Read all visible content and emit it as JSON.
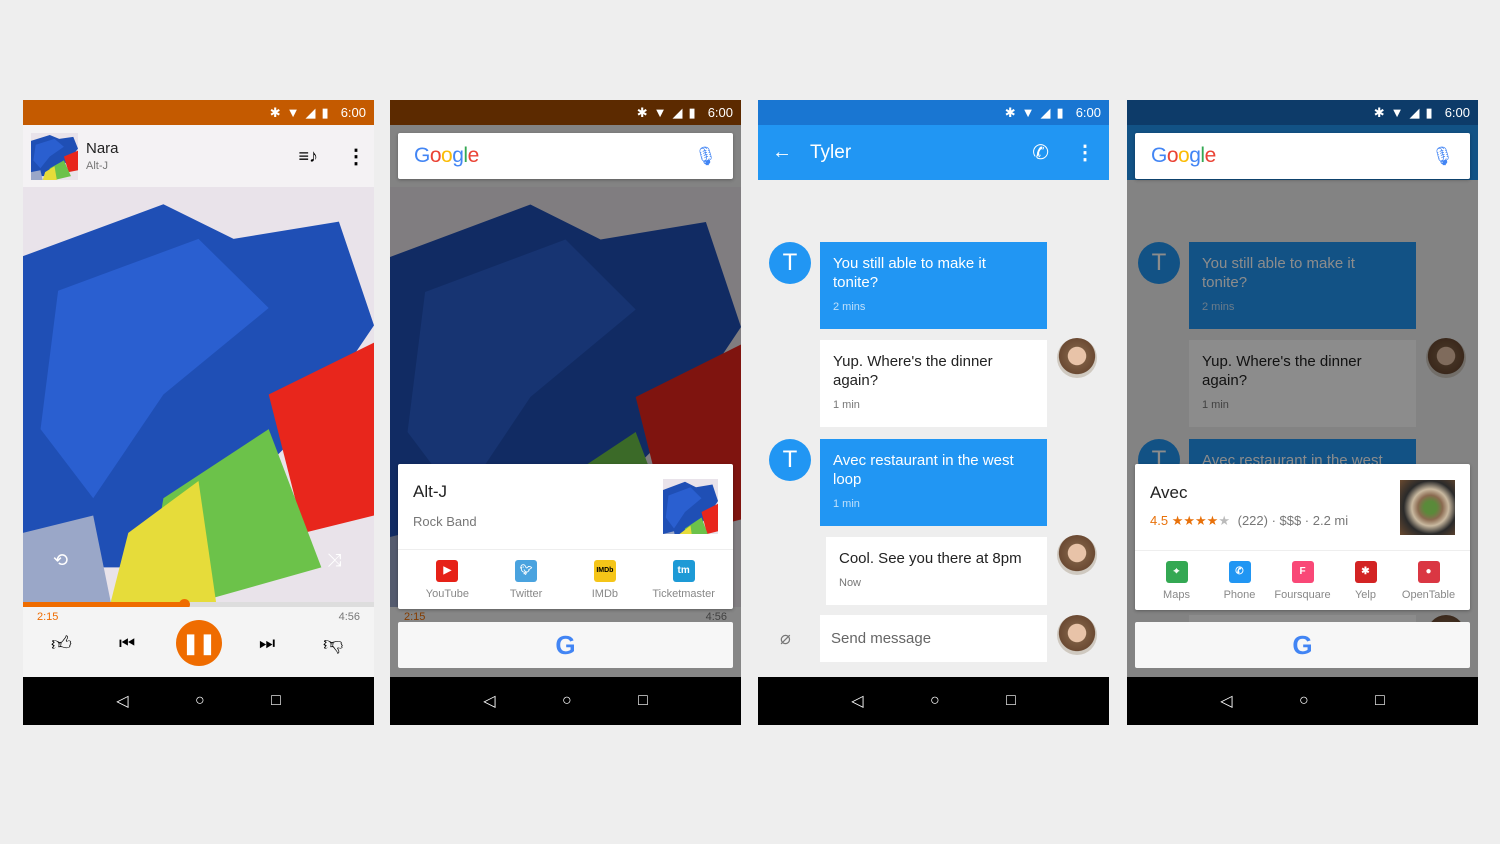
{
  "status": {
    "time": "6:00"
  },
  "player": {
    "track": "Nara",
    "artist": "Alt-J",
    "elapsed": "2:15",
    "duration": "4:56",
    "progress": 0.46,
    "accent": "#ef6c00",
    "statusbar": "#c45a00"
  },
  "google_now_music": {
    "search_logo": "Google",
    "card_title": "Alt-J",
    "card_subtitle": "Rock Band",
    "apps": [
      {
        "label": "YouTube",
        "icon": "youtube-icon",
        "color": "#e62117"
      },
      {
        "label": "Twitter",
        "icon": "twitter-icon",
        "color": "#4aa3df"
      },
      {
        "label": "IMDb",
        "icon": "imdb-icon",
        "color": "#f5c518"
      },
      {
        "label": "Ticketmaster",
        "icon": "ticketmaster-icon",
        "color": "#1d9ad6"
      }
    ],
    "elapsed": "2:15",
    "duration": "4:56"
  },
  "chat": {
    "contact": "Tyler",
    "accent": "#2196f3",
    "statusbar": "#1976d2",
    "messages": [
      {
        "from": "T",
        "text": "You still able to make it tonite?",
        "time": "2 mins",
        "incoming": true
      },
      {
        "text": "Yup. Where's the dinner again?",
        "time": "1 min",
        "incoming": false
      },
      {
        "from": "T",
        "text": "Avec restaurant in the west loop",
        "time": "1 min",
        "incoming": true
      },
      {
        "text": "Cool. See you there at 8pm",
        "time": "Now",
        "incoming": false
      }
    ],
    "input_placeholder": "Send message"
  },
  "google_now_place": {
    "search_logo": "Google",
    "card_title": "Avec",
    "rating": "4.5",
    "stars": 4.5,
    "details": "(222) · $$$ · 2.2 mi",
    "apps": [
      {
        "label": "Maps",
        "icon": "maps-icon",
        "color": "#34a853"
      },
      {
        "label": "Phone",
        "icon": "phone-icon",
        "color": "#2196f3"
      },
      {
        "label": "Foursquare",
        "icon": "foursquare-icon",
        "color": "#f94877"
      },
      {
        "label": "Yelp",
        "icon": "yelp-icon",
        "color": "#d32323"
      },
      {
        "label": "OpenTable",
        "icon": "opentable-icon",
        "color": "#da3743"
      }
    ]
  }
}
